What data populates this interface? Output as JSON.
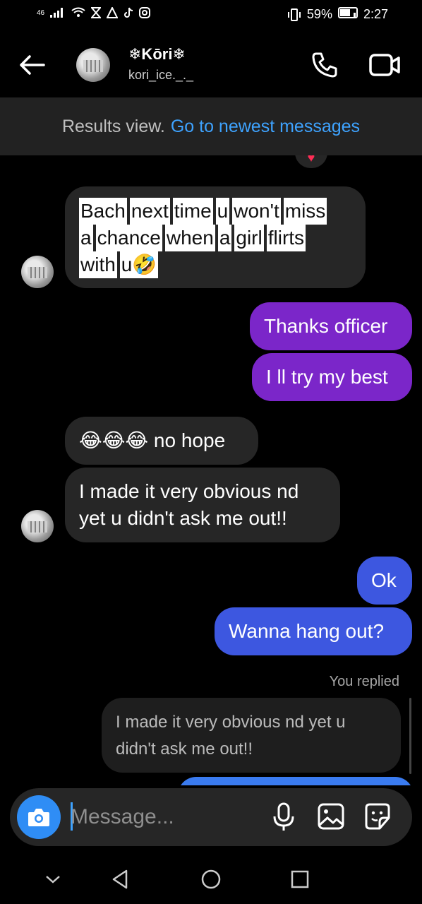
{
  "status_bar": {
    "signal": "46",
    "battery": "59%",
    "time": "2:27"
  },
  "header": {
    "name": "❄Kōri❄",
    "username": "kori_ice._._"
  },
  "banner": {
    "prefix": "Results view.",
    "link": "Go to newest messages"
  },
  "messages": {
    "m1_line1": [
      "Bach",
      "next",
      "time",
      "u",
      "won't",
      "miss"
    ],
    "m1_line2": [
      "a",
      "chance",
      "when",
      "a",
      "girl",
      "flirts"
    ],
    "m1_line3_word": "with",
    "m1_line3_tail": "u🤣",
    "m2": "Thanks officer",
    "m3": "I ll try my best",
    "m4": "😂😂😂 no hope",
    "m5": "I made it very obvious nd yet u didn't ask me out!!",
    "m6": "Ok",
    "m7": "Wanna hang out?",
    "you_replied": "You replied",
    "quoted": "I made it very obvious nd yet u didn't ask me out!!"
  },
  "composer": {
    "placeholder": "Message..."
  },
  "colors": {
    "purple": "#7b26c9",
    "blue": "#3d57e0",
    "incoming": "#262626",
    "link": "#3ea3ff"
  }
}
